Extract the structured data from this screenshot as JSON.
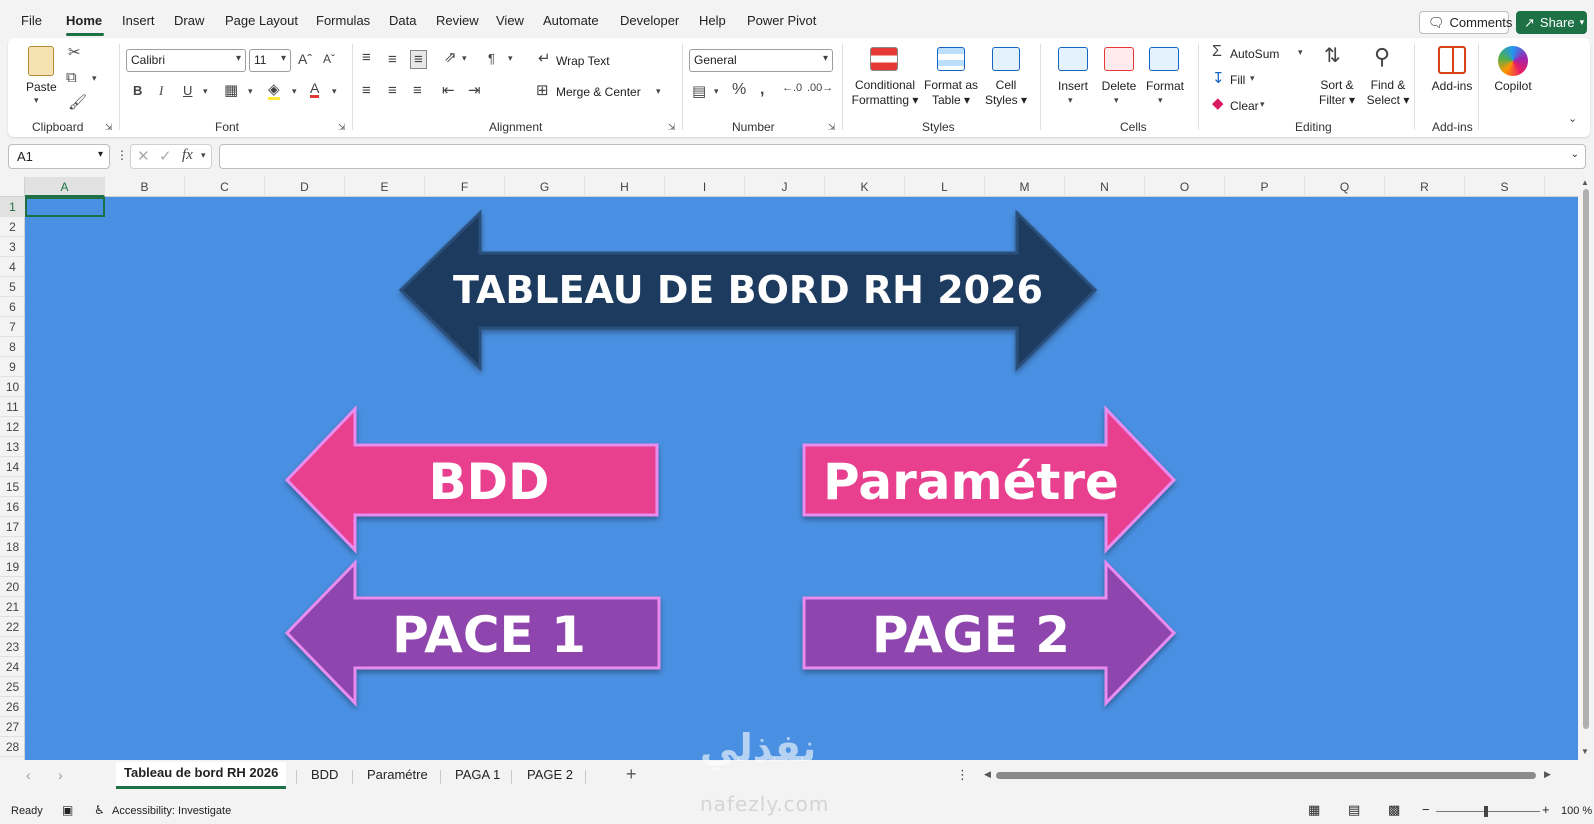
{
  "menu": {
    "items": [
      "File",
      "Home",
      "Insert",
      "Draw",
      "Page Layout",
      "Formulas",
      "Data",
      "Review",
      "View",
      "Automate",
      "Developer",
      "Help",
      "Power Pivot"
    ],
    "active": "Home",
    "comments_label": "Comments",
    "share_label": "Share"
  },
  "ribbon": {
    "clipboard": {
      "label": "Clipboard",
      "paste_label": "Paste"
    },
    "font": {
      "label": "Font",
      "font_name": "Calibri",
      "font_size": "11",
      "bold": "B",
      "italic": "I",
      "underline": "U"
    },
    "alignment": {
      "label": "Alignment",
      "wrap_text": "Wrap Text",
      "merge_center": "Merge & Center"
    },
    "number": {
      "label": "Number",
      "format": "General"
    },
    "styles": {
      "label": "Styles",
      "conditional_formatting": [
        "Conditional",
        "Formatting"
      ],
      "format_as_table": [
        "Format as",
        "Table"
      ],
      "cell_styles": [
        "Cell",
        "Styles"
      ]
    },
    "cells": {
      "label": "Cells",
      "insert": "Insert",
      "delete": "Delete",
      "format": "Format"
    },
    "editing": {
      "label": "Editing",
      "autosum": "AutoSum",
      "fill": "Fill",
      "clear": "Clear",
      "sort_filter": [
        "Sort &",
        "Filter"
      ],
      "find_select": [
        "Find &",
        "Select"
      ]
    },
    "addins": {
      "label": "Add-ins",
      "addins_btn": "Add-ins"
    },
    "copilot": {
      "label": "Copilot"
    }
  },
  "formula_bar": {
    "name_box": "A1",
    "formula": ""
  },
  "columns": [
    "A",
    "B",
    "C",
    "D",
    "E",
    "F",
    "G",
    "H",
    "I",
    "J",
    "K",
    "L",
    "M",
    "N",
    "O",
    "P",
    "Q",
    "R",
    "S"
  ],
  "rows": [
    "1",
    "2",
    "3",
    "4",
    "5",
    "6",
    "7",
    "8",
    "9",
    "10",
    "11",
    "12",
    "13",
    "14",
    "15",
    "16",
    "17",
    "18",
    "19",
    "20",
    "21",
    "22",
    "23",
    "24",
    "25",
    "26",
    "27",
    "28"
  ],
  "selected_cell": "A1",
  "shapes": {
    "title": "TABLEAU DE BORD RH 2026",
    "bdd": "BDD",
    "parametre": "Paramétre",
    "page1": "PACE 1",
    "page2": "PAGE 2"
  },
  "colors": {
    "canvas_bg": "#4a90e2",
    "title_arrow": "#1f3a5f",
    "pink_arrow": "#e8418f",
    "purple_arrow": "#8e44ad",
    "arrow_border": "#e98cf0",
    "accent": "#1e7145"
  },
  "sheet_tabs": [
    "Tableau de bord RH 2026",
    "BDD",
    "Paramétre",
    "PAGA 1",
    "PAGE 2"
  ],
  "active_tab": "Tableau de bord RH 2026",
  "status": {
    "ready": "Ready",
    "accessibility": "Accessibility: Investigate",
    "zoom": "100 %"
  },
  "watermark": {
    "logo": "نفذلي",
    "url": "nafezly.com"
  }
}
